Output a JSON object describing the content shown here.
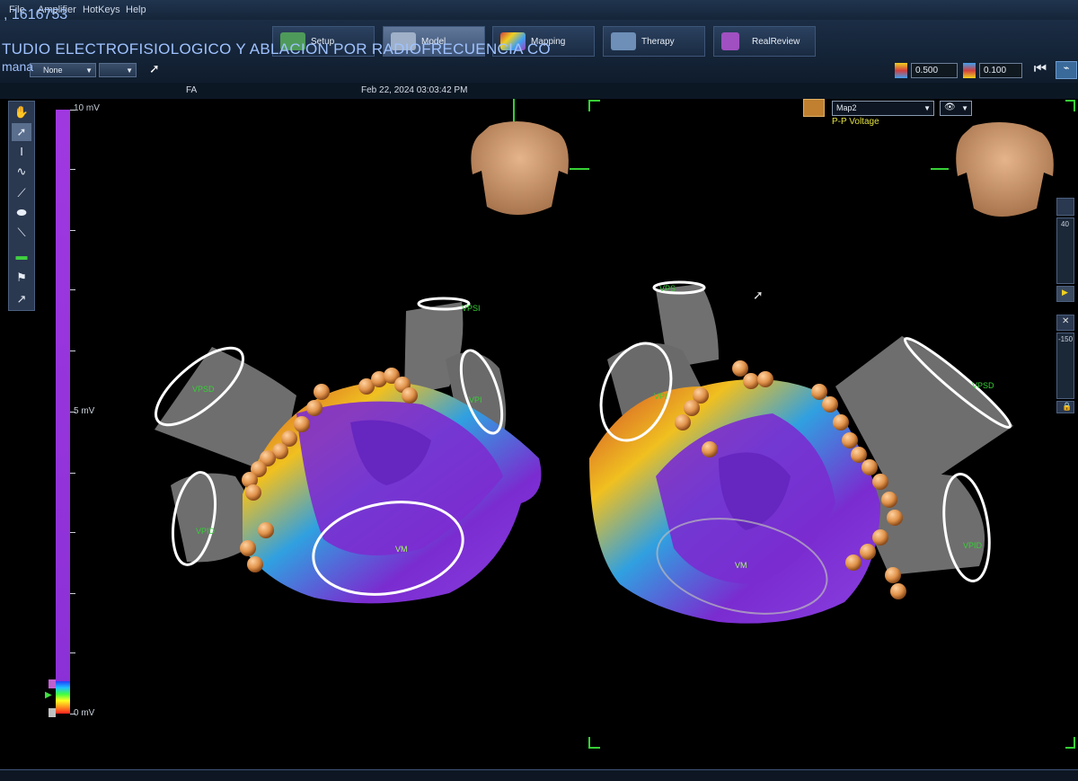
{
  "app": {
    "patient_id": ", 1616753",
    "study_title": "TUDIO ELECTROFISIOLOGICO Y ABLACION POR RADIOFRECUENCIA CO",
    "study_sub": "mana"
  },
  "menu": {
    "items": [
      {
        "label": "File"
      },
      {
        "label": "Amplifier"
      },
      {
        "label": "HotKeys"
      },
      {
        "label": "Help"
      }
    ]
  },
  "tabs": [
    {
      "label": "Setup",
      "color": "#4e9a5a"
    },
    {
      "label": "Model",
      "color": "#9fb0c8"
    },
    {
      "label": "Mapping",
      "color": "#c048c0"
    },
    {
      "label": "Therapy",
      "color": "#6d8fb8"
    },
    {
      "label": "RealReview",
      "color": "#a050c0"
    }
  ],
  "controls": {
    "left_combo": "None",
    "spin1": "0.500",
    "spin2": "0.100"
  },
  "info": {
    "label": "FA",
    "datetime": "Feb 22, 2024 03:03:42 PM"
  },
  "scale": {
    "max": "10 mV",
    "mid": "5 mV",
    "min": "0 mV"
  },
  "map": {
    "name": "Map2",
    "type": "P-P Voltage"
  },
  "left_view": {
    "labels": [
      "VPSI",
      "VPSD",
      "VPI",
      "VPID",
      "VM"
    ]
  },
  "right_view": {
    "labels": [
      "VPS",
      "VPI",
      "VPSD",
      "VPID",
      "VM"
    ]
  },
  "side": {
    "val1": "40",
    "val2": "-150"
  },
  "colors": {
    "accent": "#9fc2ff",
    "green_marker": "#36d036",
    "orange_point": "#e09a50"
  }
}
